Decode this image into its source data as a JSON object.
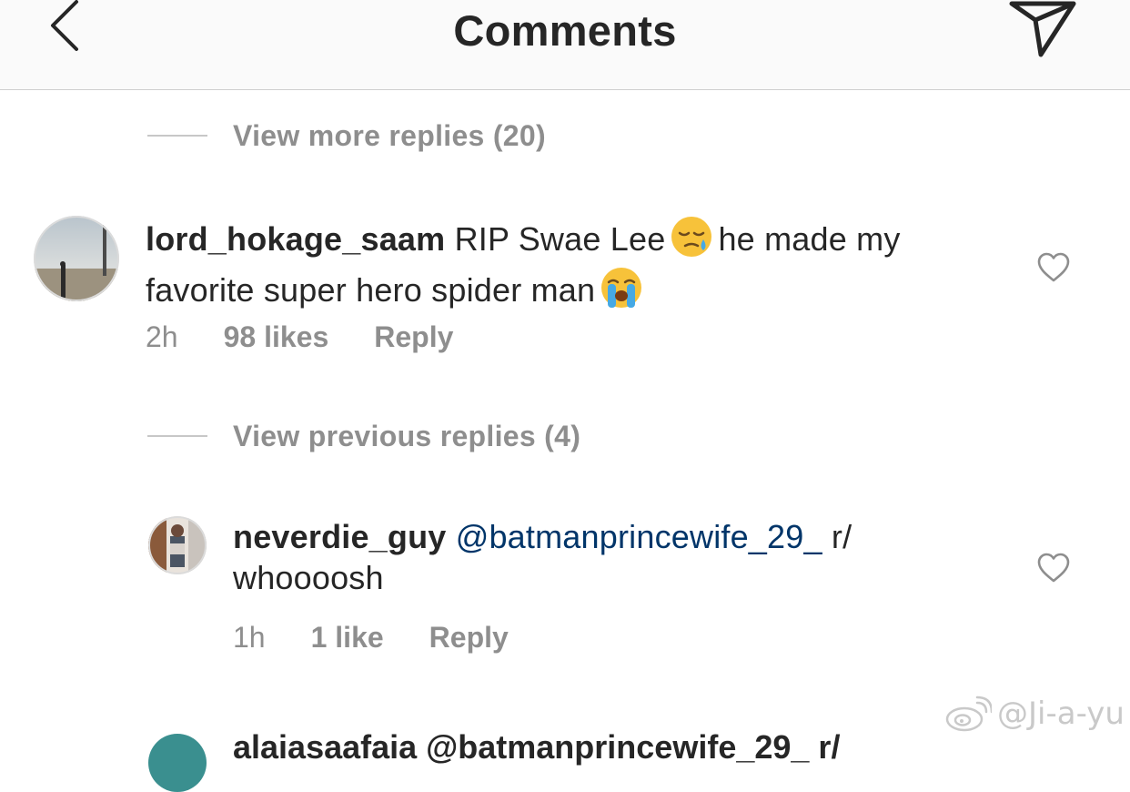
{
  "header": {
    "title": "Comments",
    "back_icon": "chevron-left-icon",
    "send_icon": "paper-plane-icon"
  },
  "thread": {
    "view_more_replies": "View more replies (20)",
    "view_previous_replies": "View previous replies (4)"
  },
  "comments": [
    {
      "username": "lord_hokage_saam",
      "text_1": "RIP Swae Lee",
      "emoji_1": "sleepy-face-emoji",
      "text_2": "he made my",
      "line_2": "favorite super hero spider man",
      "emoji_2": "loudly-crying-face-emoji",
      "time": "2h",
      "likes": "98 likes",
      "reply": "Reply"
    },
    {
      "username": "neverdie_guy",
      "mention": "@batmanprincewife_29_",
      "text_1": "r/",
      "line_2": "whoooosh",
      "time": "1h",
      "likes": "1 like",
      "reply": "Reply"
    }
  ],
  "partial_comment": {
    "text": "alaiasaafaia @batmanprincewife_29_ r/"
  },
  "watermark": {
    "text": "@Ji-a-yu"
  },
  "colors": {
    "header_bg": "#fafafa",
    "text": "#262626",
    "muted": "#8e8e8e",
    "mention": "#003569"
  }
}
